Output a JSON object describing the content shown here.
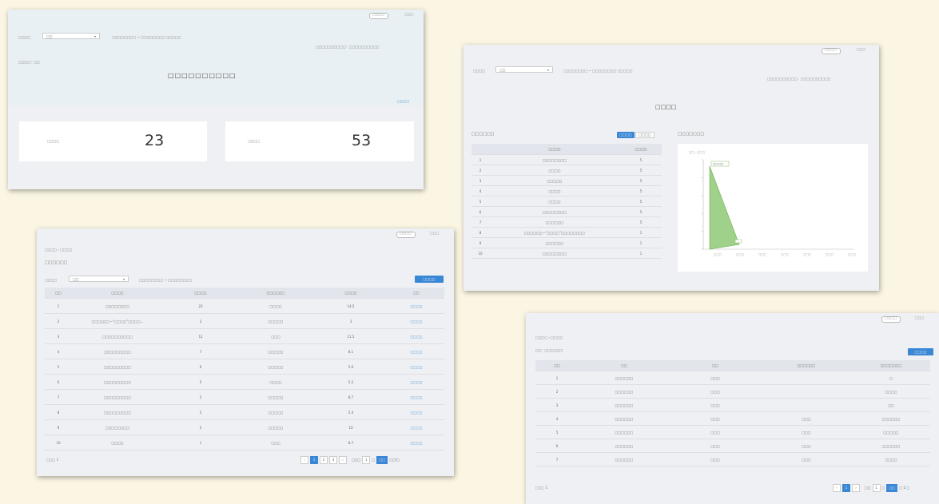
{
  "card1": {
    "topbar_a": "□□□□",
    "topbar_b": "□□□",
    "filter_label": "□□□□",
    "filter_value": "□□",
    "date_range": "□□□□□□□□ ~ □□□□□□□□ □□□□□",
    "note": "□□□□□□□□□□：□□□□□□□□□□",
    "sub_label": "□□□□：□□",
    "title": "□□□□□□□□□□",
    "link": "□□□□",
    "stats": [
      {
        "label": "□□□□",
        "value": "23"
      },
      {
        "label": "□□□□",
        "value": "53"
      }
    ]
  },
  "card2": {
    "topbar_a": "□□□□",
    "topbar_b": "□□□",
    "filter_label": "□□□□",
    "filter_value": "□□",
    "date_range": "□□□□□□□□ ~ □□□□□□□□ □□□□□",
    "note": "□□□□□□□□□□：□□□□□□□□□□",
    "title": "□□□□",
    "left_title": "□□□□□□",
    "toggle_a": "□□□□",
    "toggle_b": "□□□□",
    "right_title": "□□□□□□□",
    "table": {
      "headers": [
        "",
        "□□□□",
        "□□□□"
      ],
      "rows": [
        [
          "1",
          "□□□□□□□□",
          "5"
        ],
        [
          "2",
          "□□□□",
          "5"
        ],
        [
          "3",
          "□□□□□",
          "5"
        ],
        [
          "4",
          "□□□□",
          "5"
        ],
        [
          "5",
          "□□□□",
          "5"
        ],
        [
          "6",
          "□□□□□□□□",
          "5"
        ],
        [
          "7",
          "□□□□□□",
          "5"
        ],
        [
          "8",
          "□□□□□□—“□□□□”□□□□□□□□",
          "1"
        ],
        [
          "9",
          "□□□□□□",
          "1"
        ],
        [
          "10",
          "□□□□□□□□",
          "1"
        ]
      ]
    },
    "chart_legend": "□□：□□□",
    "chart_peak_label": "□□□□",
    "chart_xticks": [
      "□□□",
      "□□□",
      "□□□",
      "□□□",
      "□□□",
      "□□□",
      "□□□"
    ]
  },
  "card3": {
    "topbar_a": "□□□□",
    "topbar_b": "□□□",
    "breadcrumb": "□□□□ › □□□□",
    "title": "□□□□□□",
    "filter_label": "□□□□",
    "filter_value": "□□",
    "date_range": "□□□□□□□□ ~ □□□□□□□□",
    "export": "□□□□",
    "table": {
      "headers": [
        "□□",
        "□□□□",
        "□□□□",
        "□□□□□□",
        "□□□□",
        "□□"
      ],
      "rows": [
        [
          "1",
          "□□□□□□□□",
          "23",
          "□□□□",
          "14.5",
          "□□□□"
        ],
        [
          "2",
          "□□□□□□—“□□□□”□□□□...",
          "3",
          "□□□□□",
          "3",
          "□□□□"
        ],
        [
          "3",
          "□□□□□□□□□□",
          "12",
          "□□□",
          "11.5",
          "□□□□"
        ],
        [
          "4",
          "□□□□□□□□□",
          "7",
          "□□□□□",
          "8.1",
          "□□□□"
        ],
        [
          "5",
          "□□□□□□□□□",
          "6",
          "□□□□□",
          "5.6",
          "□□□□"
        ],
        [
          "6",
          "□□□□□□□□□",
          "5",
          "□□□□",
          "5.2",
          "□□□□"
        ],
        [
          "7",
          "□□□□□□□□□",
          "5",
          "□□□□□",
          "8.7",
          "□□□□"
        ],
        [
          "8",
          "□□□□□□□□□",
          "5",
          "□□□□□",
          "5.4",
          "□□□□"
        ],
        [
          "9",
          "□□□□□□□□",
          "5",
          "□□□□□",
          "10",
          "□□□□"
        ],
        [
          "10",
          "□□□□",
          "1",
          "□□□",
          "8.7",
          "□□□□"
        ]
      ]
    },
    "total": "□□□ 1",
    "pages": [
      "‹",
      "1",
      "2",
      "3",
      "›"
    ],
    "goto_label": "□□□",
    "goto_value": "1",
    "page_unit": "□",
    "goto_btn": "□□",
    "per_page": "□□/□"
  },
  "card4": {
    "topbar_a": "□□□□",
    "topbar_b": "□□□",
    "breadcrumb": "□□□□ › □□□□",
    "course": "□□：□□□□□□",
    "export": "□□□□",
    "table": {
      "headers": [
        "□□",
        "□□",
        "□□",
        "□□□□□□",
        "□□□□□□□"
      ],
      "rows": [
        [
          "1",
          "□□□□□□",
          "□□□",
          "",
          "□"
        ],
        [
          "2",
          "□□□□□□",
          "□□□",
          "",
          "□□□□"
        ],
        [
          "3",
          "□□□□□□",
          "□□□",
          "",
          "□□"
        ],
        [
          "4",
          "□□□□□□",
          "□□□",
          "□□□",
          "□□□□□□"
        ],
        [
          "5",
          "□□□□□□",
          "□□□",
          "□□□",
          "□□□□□"
        ],
        [
          "6",
          "□□□□□□",
          "□□□",
          "□□□",
          "□□□□□□"
        ],
        [
          "7",
          "□□□□□□",
          "□□□",
          "□□□",
          "□□□□"
        ]
      ]
    },
    "total": "□□□ 1",
    "pages": [
      "‹",
      "1",
      "›"
    ],
    "goto_label": "□□",
    "goto_value": "1",
    "page_unit": "□",
    "goto_btn": "□□",
    "per_page": "□ 1 □"
  }
}
